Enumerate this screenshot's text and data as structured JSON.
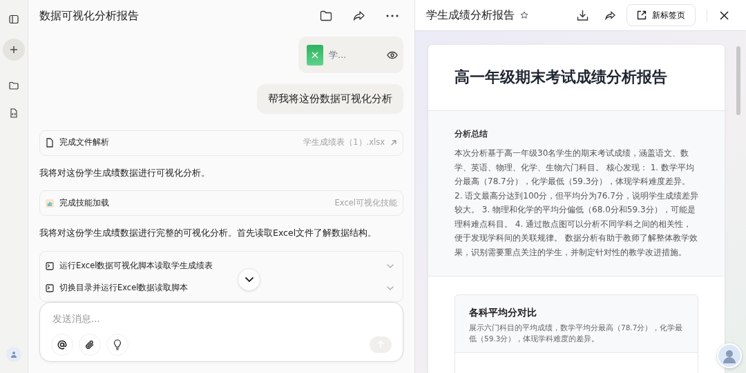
{
  "chat": {
    "title": "数据可视化分析报告",
    "attachment": {
      "name": "学..."
    },
    "user_message": "帮我将这份数据可视化分析",
    "items": [
      {
        "kind": "file_step",
        "label": "完成文件解析",
        "detail": "学生成绩表（1）.xlsx"
      },
      {
        "kind": "text",
        "text": "我将对这份学生成绩数据进行可视化分析。"
      },
      {
        "kind": "skill_step",
        "label": "完成技能加载",
        "detail": "Excel可视化技能"
      },
      {
        "kind": "text",
        "text": "我将对这份学生成绩数据进行完整的可视化分析。首先读取Excel文件了解数据结构。"
      },
      {
        "kind": "command_group",
        "steps": [
          {
            "label": "运行Excel数据可视化脚本读取学生成绩表",
            "expanded": false
          },
          {
            "label": "切换目录并运行Excel数据读取脚本",
            "expanded": false
          }
        ]
      }
    ],
    "composer": {
      "placeholder": "发送消息..."
    }
  },
  "preview": {
    "title": "学生成绩分析报告",
    "starred": false,
    "open_tab_label": "新标签页",
    "report": {
      "title": "高一年级期末考试成绩分析报告",
      "summary_heading": "分析总结",
      "summary": "本次分析基于高一年级30名学生的期末考试成绩，涵盖语文、数学、英语、物理、化学、生物六门科目。 核心发现： 1. 数学平均分最高（78.7分），化学最低（59.3分），体现学科难度差异。 2. 语文最高分达到100分，但平均分为76.7分，说明学生成绩差异较大。 3. 物理和化学的平均分偏低（68.0分和59.3分），可能是理科难点科目。 4. 通过散点图可以分析不同学科之间的相关性，便于发现学科间的关联规律。 数据分析有助于教师了解整体教学效果，识别需要重点关注的学生，并制定针对性的教学改进措施。",
      "section": {
        "title": "各科平均分对比",
        "description": "展示六门科目的平均成绩，数学平均分最高（78.7分），化学最低（59.3分），体现学科难度的差异。"
      }
    }
  }
}
